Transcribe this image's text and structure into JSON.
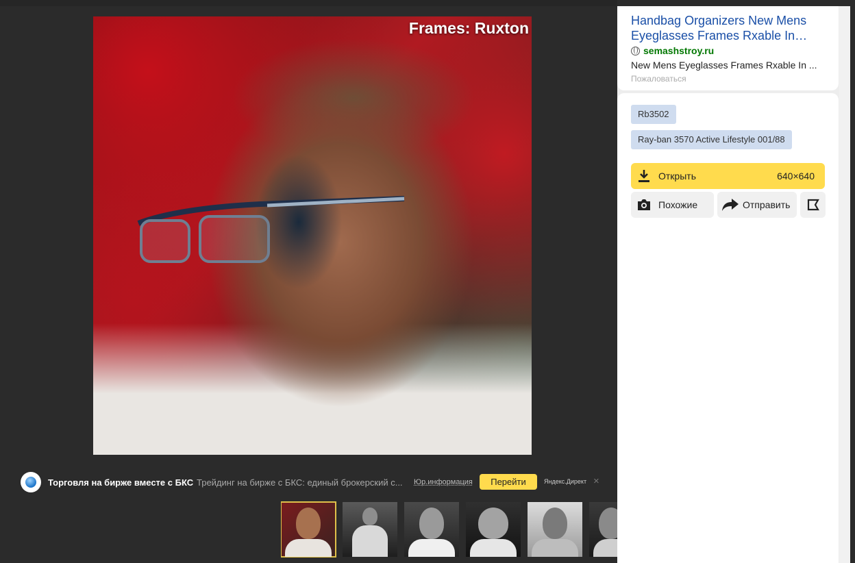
{
  "viewer": {
    "image_caption": "Frames: Ruxton"
  },
  "ad": {
    "title": "Торговля на бирже вместе с БКС",
    "description": "Трейдинг на бирже с БКС: единый брокерский с...",
    "legal": "Юр.информация",
    "go_label": "Перейти",
    "network": "Яндекс.Директ",
    "close": "×"
  },
  "result": {
    "title": "Handbag Organizers New Mens Eyeglasses Frames Rxable In…",
    "site": "semashstroy.ru",
    "snippet": "New Mens Eyeglasses Frames Rxable In ...",
    "complain": "Пожаловаться"
  },
  "tags": [
    "Rb3502",
    "Ray-ban 3570 Active Lifestyle 001/88"
  ],
  "actions": {
    "open_label": "Открыть",
    "open_size": "640×640",
    "similar_label": "Похожие",
    "share_label": "Отправить"
  },
  "icons": {
    "download": "download-icon",
    "camera": "camera-icon",
    "share": "share-arrow-icon",
    "collection": "bookmark-icon",
    "globe": "globe-icon"
  },
  "colors": {
    "accent": "#ffdb4d",
    "link": "#1a4fa7",
    "site": "#007700",
    "tag_bg": "#cfdcef"
  }
}
